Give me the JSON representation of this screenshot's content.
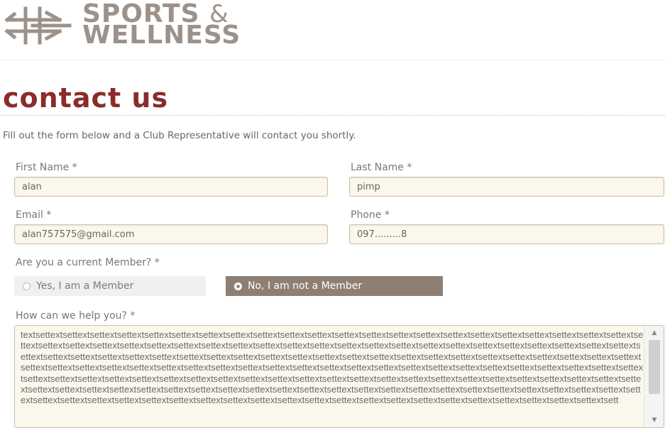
{
  "brand": {
    "line1": "SPORTS",
    "amp": "&",
    "line2": "WELLNESS",
    "color": "#9c928a"
  },
  "page": {
    "title": "contact us",
    "title_color": "#8b2b2b",
    "intro": "Fill out the form below and a Club Representative will contact you shortly."
  },
  "form": {
    "first_name": {
      "label": "First Name *",
      "value": "alan"
    },
    "last_name": {
      "label": "Last Name *",
      "value": "pimp"
    },
    "email": {
      "label": "Email *",
      "value": "alan757575@gmail.com"
    },
    "phone": {
      "label": "Phone *",
      "value": "097.........8"
    },
    "member": {
      "label": "Are you a current Member? *",
      "options": [
        {
          "label": "Yes, I am a Member",
          "selected": false
        },
        {
          "label": "No, I am not a Member",
          "selected": true
        }
      ],
      "selected_color": "#8e7f74"
    },
    "help": {
      "label": "How can we help you? *",
      "value": "textsettextsettextsettextsettextsettextsettextsettextsettextsettextsettextsettextsettextsettextsettextsettextsettextsettextsettextsettextsettextsettextsettextsettextsettextsettextsettextsettextsettextsettextsettextsettextsettextsettextsettextsettextsettextsettextsettextsettextsettextsettextsettextsettextsettextsettextsettextsettextsettextsettextsettextsettextsettextsettextsettextsettextsettextsettextsettextsettextsettextsettextsettextsettextsettextsettextsettextsettextsettextsettextsettextsettextsettextsettextsettextsettextsettextsettextsettextsettextsettextsettextsettextsettextsettextsettextsettextsettextsettextsettextsettextsettextsettextsettextsettextsettextsettextsettextsettextsettextsettextsettextsettextsettextsettextsettextsettextsettextsettextsettextsettextsettextsettextsettextsettextsettextsettextsettextsettextsettextsettextsettextsettextsettextsettextsettextsettextsettextsettextsettextsettextsettextsettextsettextsettextsettextsettextsettextsettextsettextsettextsettextsettextsettextsettextsettextsettextsettextsettextsettextsettextsettextsettextsettextsettextsettextsettextsettextsettextsett"
    }
  },
  "icons": {
    "logo": "sports-wellness-logo-icon",
    "scroll_up": "scroll-up-arrow-icon",
    "scroll_down": "scroll-down-arrow-icon"
  }
}
